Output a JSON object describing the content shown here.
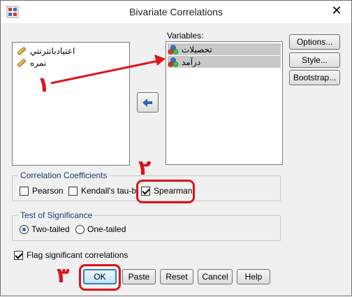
{
  "window": {
    "title": "Bivariate Correlations"
  },
  "source_list": {
    "items": [
      {
        "label": "اعتيادبانترنتي",
        "icon": "scale-variable-icon"
      },
      {
        "label": "نمره",
        "icon": "scale-variable-icon"
      }
    ]
  },
  "variables": {
    "label": "Variables:",
    "items": [
      {
        "label": "تحصيلات",
        "icon": "nominal-variable-icon"
      },
      {
        "label": "درآمد",
        "icon": "nominal-variable-icon"
      }
    ]
  },
  "side_buttons": {
    "options": "Options...",
    "style": "Style...",
    "bootstrap": "Bootstrap..."
  },
  "coefficients": {
    "title": "Correlation Coefficients",
    "pearson": {
      "label": "Pearson",
      "checked": false
    },
    "kendall": {
      "label": "Kendall's tau-b",
      "checked": false
    },
    "spearman": {
      "label": "Spearman",
      "checked": true
    }
  },
  "significance": {
    "title": "Test of Significance",
    "two_tailed": {
      "label": "Two-tailed",
      "selected": true
    },
    "one_tailed": {
      "label": "One-tailed",
      "selected": false
    }
  },
  "flag": {
    "label": "Flag significant correlations",
    "checked": true
  },
  "buttons": {
    "ok": "OK",
    "paste": "Paste",
    "reset": "Reset",
    "cancel": "Cancel",
    "help": "Help"
  },
  "annotations": {
    "n1": "١",
    "n2": "٢",
    "n3": "٣",
    "color": "#d9151b"
  }
}
